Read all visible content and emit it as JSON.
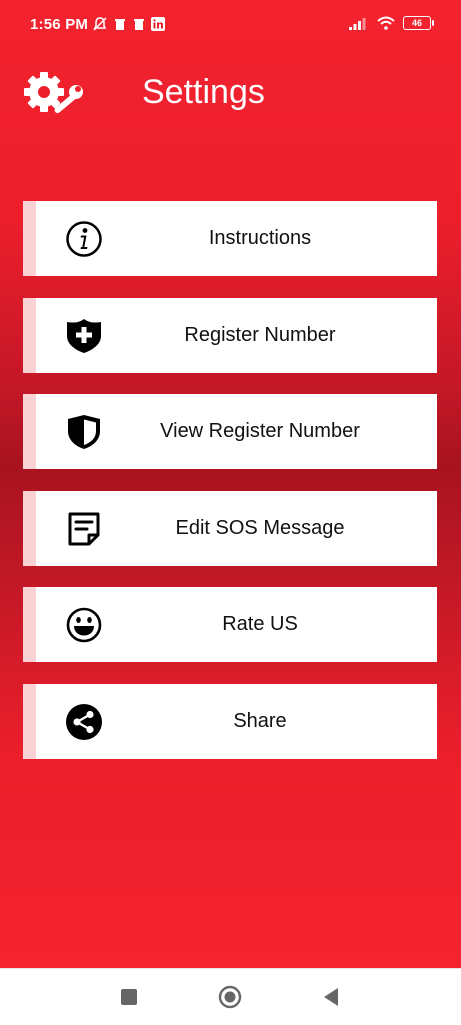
{
  "status_bar": {
    "time": "1:56 PM",
    "battery": "46",
    "left_icons": [
      "muted-bell-icon",
      "trash-icon",
      "trash-icon",
      "linkedin-icon"
    ],
    "right_icons": [
      "signal-icon",
      "wifi-icon",
      "battery-icon"
    ]
  },
  "header": {
    "title": "Settings",
    "icon": "settings-wrench-gear-icon"
  },
  "menu": {
    "items": [
      {
        "label": "Instructions",
        "icon": "info-circle-icon"
      },
      {
        "label": "Register Number",
        "icon": "shield-plus-icon"
      },
      {
        "label": "View Register Number",
        "icon": "shield-half-icon"
      },
      {
        "label": "Edit SOS Message",
        "icon": "note-icon"
      },
      {
        "label": "Rate US",
        "icon": "smiley-icon"
      },
      {
        "label": "Share",
        "icon": "share-icon"
      }
    ]
  },
  "colors": {
    "background_primary": "#f2222f",
    "background_dark": "#a8131f",
    "menu_accent": "#fbd2d4",
    "text_dark": "#111111"
  },
  "navbar": {
    "buttons": [
      "recent-apps-button",
      "home-button",
      "back-button"
    ]
  }
}
